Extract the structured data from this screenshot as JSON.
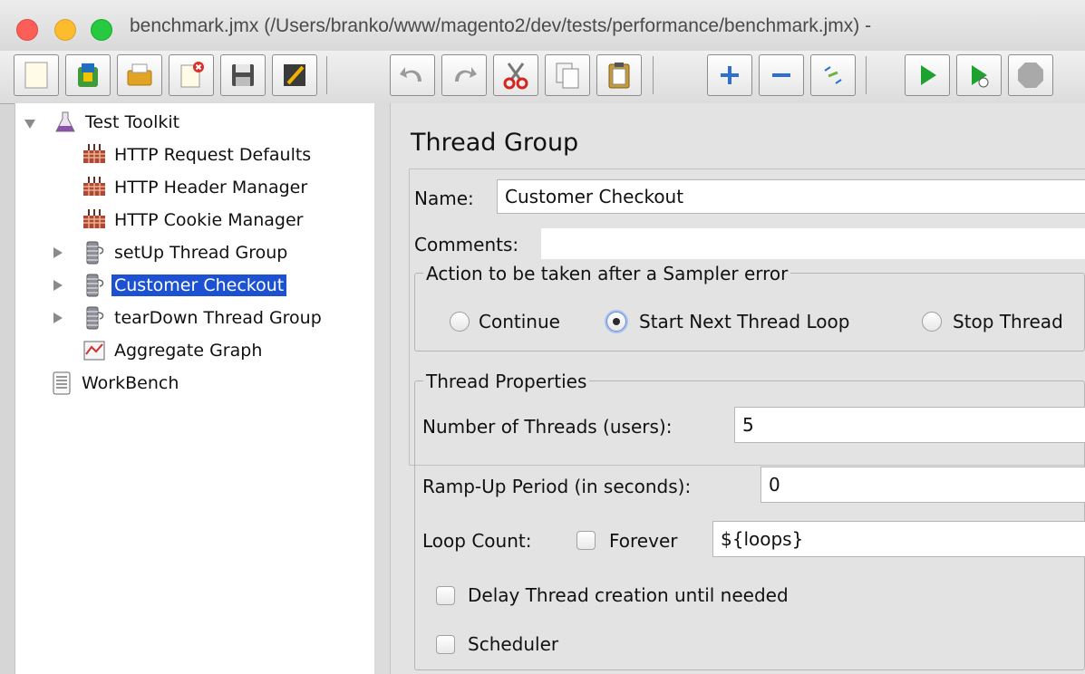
{
  "window": {
    "title": "benchmark.jmx (/Users/branko/www/magento2/dev/tests/performance/benchmark.jmx) -"
  },
  "toolbar": {
    "buttons": [
      {
        "name": "new-icon"
      },
      {
        "name": "templates-icon"
      },
      {
        "name": "open-icon"
      },
      {
        "name": "close-icon"
      },
      {
        "name": "save-icon"
      },
      {
        "name": "save-as-icon"
      },
      {
        "name": "undo-icon"
      },
      {
        "name": "redo-icon"
      },
      {
        "name": "cut-icon"
      },
      {
        "name": "copy-icon"
      },
      {
        "name": "paste-icon"
      },
      {
        "name": "expand-icon"
      },
      {
        "name": "collapse-icon"
      },
      {
        "name": "toggle-icon"
      },
      {
        "name": "start-icon"
      },
      {
        "name": "start-no-pause-icon"
      },
      {
        "name": "stop-icon"
      }
    ]
  },
  "tree": {
    "items": [
      {
        "label": "Test Toolkit",
        "icon": "flask-icon",
        "expanded": true,
        "selected": false
      },
      {
        "label": "HTTP Request Defaults",
        "icon": "config-element-icon",
        "selected": false
      },
      {
        "label": "HTTP Header Manager",
        "icon": "config-element-icon",
        "selected": false
      },
      {
        "label": "HTTP Cookie Manager",
        "icon": "config-element-icon",
        "selected": false
      },
      {
        "label": "setUp Thread Group",
        "icon": "thread-group-icon",
        "expanded": false,
        "selected": false
      },
      {
        "label": "Customer Checkout",
        "icon": "thread-group-icon",
        "expanded": false,
        "selected": true
      },
      {
        "label": "tearDown Thread Group",
        "icon": "thread-group-icon",
        "expanded": false,
        "selected": false
      },
      {
        "label": "Aggregate Graph",
        "icon": "graph-icon",
        "selected": false
      },
      {
        "label": "WorkBench",
        "icon": "workbench-icon",
        "selected": false
      }
    ]
  },
  "panel": {
    "title": "Thread Group",
    "name_label": "Name:",
    "name_value": "Customer Checkout",
    "comments_label": "Comments:",
    "comments_value": "",
    "sampler_error": {
      "legend": "Action to be taken after a Sampler error",
      "options": [
        {
          "label": "Continue",
          "selected": false
        },
        {
          "label": "Start Next Thread Loop",
          "selected": true
        },
        {
          "label": "Stop Thread",
          "selected": false
        }
      ]
    },
    "thread_properties": {
      "legend": "Thread Properties",
      "threads_label": "Number of Threads (users):",
      "threads_value": "5",
      "rampup_label": "Ramp-Up Period (in seconds):",
      "rampup_value": "0",
      "loop_label": "Loop Count:",
      "forever_label": "Forever",
      "forever_checked": false,
      "loop_value": "${loops}",
      "delay_label": "Delay Thread creation until needed",
      "delay_checked": false,
      "scheduler_label": "Scheduler",
      "scheduler_checked": false
    }
  },
  "colors": {
    "selection": "#1c52d1",
    "close": "#fc5f57",
    "minimize": "#fdbc2e",
    "maximize": "#28c840"
  }
}
